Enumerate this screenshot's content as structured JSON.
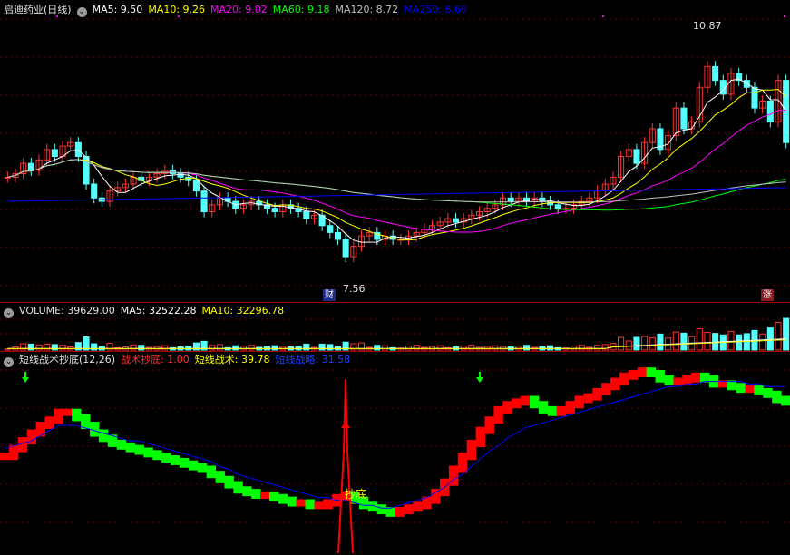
{
  "colors": {
    "up": "#ff3232",
    "down": "#54ffff",
    "ma5": "#ffffff",
    "ma10": "#ffff00",
    "ma20": "#ff00ff",
    "ma60": "#00ff00",
    "ma120": "#c0c0c0",
    "ma250": "#0000ff",
    "green": "#00ff00",
    "red": "#ff0000",
    "blue": "#0000ff",
    "yellow": "#ffff00"
  },
  "price": {
    "title": "启迪药业(日线)",
    "ma5_label": "MA5: 9.50",
    "ma10_label": "MA10: 9.26",
    "ma20_label": "MA20: 9.02",
    "ma60_label": "MA60: 9.18",
    "ma120_label": "MA120: 8.72",
    "ma250_label": "MA250: 8.66",
    "high_label": "10.87",
    "low_label": "7.56",
    "tag_cai": "财",
    "tag_zhang": "涨"
  },
  "volume": {
    "vol_label": "VOLUME: 39629.00",
    "ma5_label": "MA5: 32522.28",
    "ma10_label": "MA10: 32296.78"
  },
  "indicator": {
    "title": "短线战术抄底(12,26)",
    "zs_label": "战术抄底: 1.00",
    "dx_label": "短线战术: 39.78",
    "cl_label": "短线战略: 31.58",
    "buy_text": "抄底"
  },
  "chart_data": [
    {
      "type": "candlestick",
      "title": "启迪药业(日线)",
      "ylim": [
        7.2,
        11.2
      ],
      "high": 10.87,
      "low": 7.56,
      "close": [
        8.9,
        8.95,
        9.1,
        9.0,
        9.15,
        9.3,
        9.2,
        9.35,
        9.4,
        9.2,
        8.8,
        8.6,
        8.55,
        8.7,
        8.75,
        8.8,
        8.9,
        8.85,
        8.9,
        8.95,
        9.0,
        8.95,
        8.9,
        8.85,
        8.7,
        8.4,
        8.5,
        8.6,
        8.55,
        8.45,
        8.5,
        8.55,
        8.5,
        8.45,
        8.4,
        8.5,
        8.45,
        8.4,
        8.3,
        8.35,
        8.2,
        8.1,
        8.0,
        7.75,
        7.9,
        8.05,
        8.1,
        8.0,
        8.05,
        8.0,
        8.0,
        8.05,
        8.1,
        8.15,
        8.2,
        8.25,
        8.3,
        8.25,
        8.3,
        8.35,
        8.4,
        8.45,
        8.5,
        8.6,
        8.55,
        8.6,
        8.55,
        8.6,
        8.55,
        8.5,
        8.45,
        8.45,
        8.5,
        8.55,
        8.6,
        8.7,
        8.8,
        8.9,
        9.2,
        9.3,
        9.1,
        9.4,
        9.6,
        9.3,
        9.5,
        9.9,
        9.6,
        9.7,
        10.2,
        10.5,
        10.3,
        10.1,
        10.4,
        10.3,
        10.2,
        9.9,
        10.0,
        9.7,
        10.3,
        9.4
      ]
    },
    {
      "type": "bar",
      "title": "VOLUME",
      "last": 39629.0,
      "ma5": 32522.28,
      "ma10": 32296.78
    },
    {
      "type": "line",
      "title": "短线战术抄底(12,26)",
      "series": [
        {
          "name": "短线战术",
          "values": [
            28,
            31,
            34,
            37,
            40,
            42,
            45,
            45,
            43,
            40,
            37,
            35,
            33,
            32,
            31,
            30,
            29,
            28,
            27,
            26,
            25,
            24,
            23,
            21,
            19,
            17,
            15,
            14,
            13,
            13,
            12,
            11,
            10,
            10,
            9,
            9,
            10,
            12,
            13,
            11,
            9,
            8,
            7,
            6,
            7,
            8,
            9,
            11,
            14,
            18,
            23,
            28,
            33,
            38,
            42,
            46,
            48,
            49,
            50,
            48,
            46,
            45,
            46,
            48,
            50,
            51,
            53,
            55,
            57,
            59,
            60,
            61,
            60,
            58,
            57,
            57,
            58,
            59,
            58,
            56,
            56,
            55,
            54,
            54,
            53,
            52,
            50,
            49
          ]
        },
        {
          "name": "短线战略",
          "values": [
            31,
            32,
            33,
            34,
            36,
            38,
            40,
            40,
            40,
            39,
            38,
            37,
            36,
            35,
            34,
            34,
            33,
            32,
            31,
            30,
            29,
            28,
            27,
            26,
            24,
            23,
            21,
            20,
            19,
            18,
            17,
            16,
            15,
            14,
            13,
            12,
            12,
            11,
            11,
            10,
            9,
            9,
            8,
            8,
            9,
            10,
            11,
            12,
            14,
            16,
            19,
            21,
            24,
            27,
            30,
            32,
            35,
            37,
            39,
            40,
            41,
            42,
            43,
            44,
            45,
            46,
            47,
            48,
            49,
            50,
            51,
            52,
            53,
            54,
            55,
            55,
            56,
            56,
            57,
            57,
            57,
            57,
            57,
            56,
            56,
            55,
            55,
            55
          ]
        }
      ],
      "ylim": [
        0,
        100
      ],
      "signal": {
        "name": "战术抄底",
        "value": 1.0
      }
    }
  ]
}
